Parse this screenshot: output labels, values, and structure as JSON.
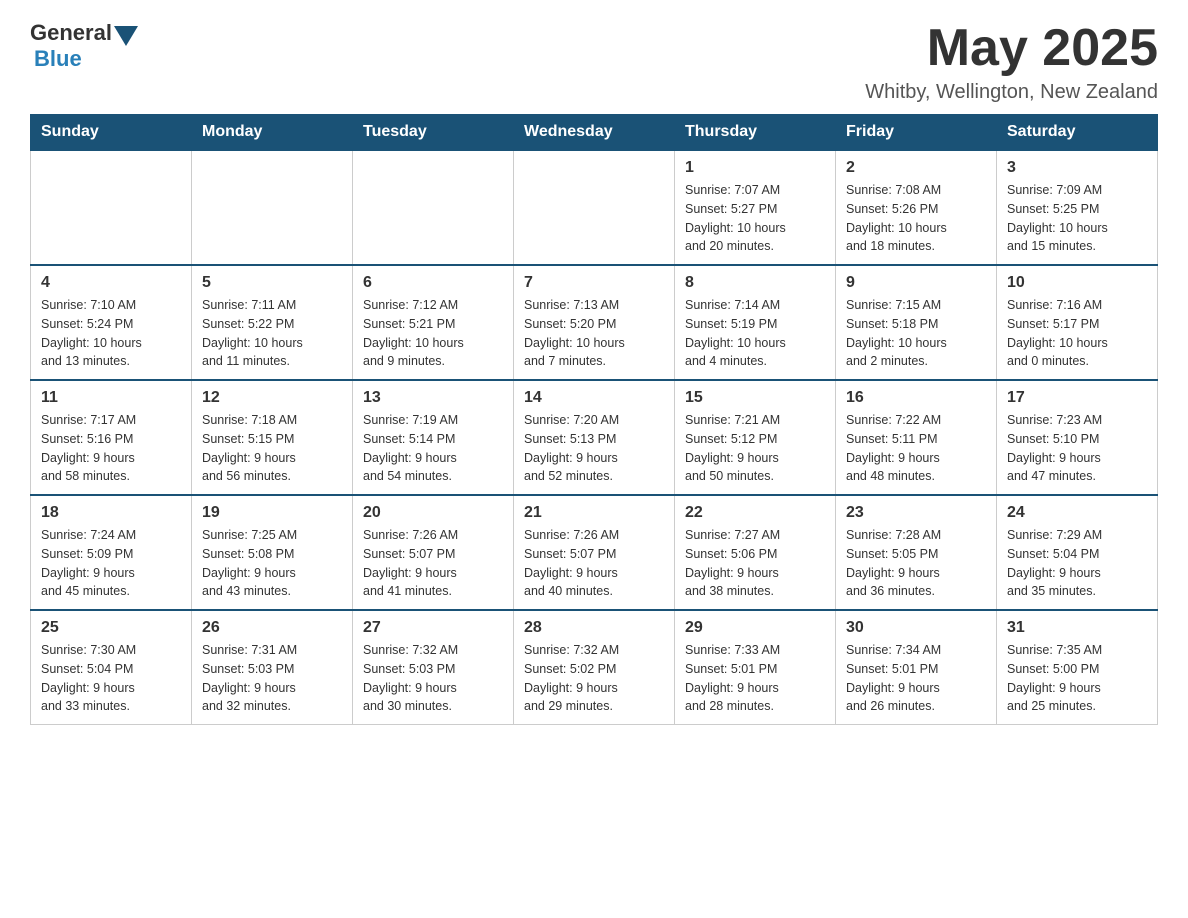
{
  "header": {
    "logo_general": "General",
    "logo_blue": "Blue",
    "month_title": "May 2025",
    "location": "Whitby, Wellington, New Zealand"
  },
  "weekdays": [
    "Sunday",
    "Monday",
    "Tuesday",
    "Wednesday",
    "Thursday",
    "Friday",
    "Saturday"
  ],
  "weeks": [
    [
      {
        "day": "",
        "info": ""
      },
      {
        "day": "",
        "info": ""
      },
      {
        "day": "",
        "info": ""
      },
      {
        "day": "",
        "info": ""
      },
      {
        "day": "1",
        "info": "Sunrise: 7:07 AM\nSunset: 5:27 PM\nDaylight: 10 hours\nand 20 minutes."
      },
      {
        "day": "2",
        "info": "Sunrise: 7:08 AM\nSunset: 5:26 PM\nDaylight: 10 hours\nand 18 minutes."
      },
      {
        "day": "3",
        "info": "Sunrise: 7:09 AM\nSunset: 5:25 PM\nDaylight: 10 hours\nand 15 minutes."
      }
    ],
    [
      {
        "day": "4",
        "info": "Sunrise: 7:10 AM\nSunset: 5:24 PM\nDaylight: 10 hours\nand 13 minutes."
      },
      {
        "day": "5",
        "info": "Sunrise: 7:11 AM\nSunset: 5:22 PM\nDaylight: 10 hours\nand 11 minutes."
      },
      {
        "day": "6",
        "info": "Sunrise: 7:12 AM\nSunset: 5:21 PM\nDaylight: 10 hours\nand 9 minutes."
      },
      {
        "day": "7",
        "info": "Sunrise: 7:13 AM\nSunset: 5:20 PM\nDaylight: 10 hours\nand 7 minutes."
      },
      {
        "day": "8",
        "info": "Sunrise: 7:14 AM\nSunset: 5:19 PM\nDaylight: 10 hours\nand 4 minutes."
      },
      {
        "day": "9",
        "info": "Sunrise: 7:15 AM\nSunset: 5:18 PM\nDaylight: 10 hours\nand 2 minutes."
      },
      {
        "day": "10",
        "info": "Sunrise: 7:16 AM\nSunset: 5:17 PM\nDaylight: 10 hours\nand 0 minutes."
      }
    ],
    [
      {
        "day": "11",
        "info": "Sunrise: 7:17 AM\nSunset: 5:16 PM\nDaylight: 9 hours\nand 58 minutes."
      },
      {
        "day": "12",
        "info": "Sunrise: 7:18 AM\nSunset: 5:15 PM\nDaylight: 9 hours\nand 56 minutes."
      },
      {
        "day": "13",
        "info": "Sunrise: 7:19 AM\nSunset: 5:14 PM\nDaylight: 9 hours\nand 54 minutes."
      },
      {
        "day": "14",
        "info": "Sunrise: 7:20 AM\nSunset: 5:13 PM\nDaylight: 9 hours\nand 52 minutes."
      },
      {
        "day": "15",
        "info": "Sunrise: 7:21 AM\nSunset: 5:12 PM\nDaylight: 9 hours\nand 50 minutes."
      },
      {
        "day": "16",
        "info": "Sunrise: 7:22 AM\nSunset: 5:11 PM\nDaylight: 9 hours\nand 48 minutes."
      },
      {
        "day": "17",
        "info": "Sunrise: 7:23 AM\nSunset: 5:10 PM\nDaylight: 9 hours\nand 47 minutes."
      }
    ],
    [
      {
        "day": "18",
        "info": "Sunrise: 7:24 AM\nSunset: 5:09 PM\nDaylight: 9 hours\nand 45 minutes."
      },
      {
        "day": "19",
        "info": "Sunrise: 7:25 AM\nSunset: 5:08 PM\nDaylight: 9 hours\nand 43 minutes."
      },
      {
        "day": "20",
        "info": "Sunrise: 7:26 AM\nSunset: 5:07 PM\nDaylight: 9 hours\nand 41 minutes."
      },
      {
        "day": "21",
        "info": "Sunrise: 7:26 AM\nSunset: 5:07 PM\nDaylight: 9 hours\nand 40 minutes."
      },
      {
        "day": "22",
        "info": "Sunrise: 7:27 AM\nSunset: 5:06 PM\nDaylight: 9 hours\nand 38 minutes."
      },
      {
        "day": "23",
        "info": "Sunrise: 7:28 AM\nSunset: 5:05 PM\nDaylight: 9 hours\nand 36 minutes."
      },
      {
        "day": "24",
        "info": "Sunrise: 7:29 AM\nSunset: 5:04 PM\nDaylight: 9 hours\nand 35 minutes."
      }
    ],
    [
      {
        "day": "25",
        "info": "Sunrise: 7:30 AM\nSunset: 5:04 PM\nDaylight: 9 hours\nand 33 minutes."
      },
      {
        "day": "26",
        "info": "Sunrise: 7:31 AM\nSunset: 5:03 PM\nDaylight: 9 hours\nand 32 minutes."
      },
      {
        "day": "27",
        "info": "Sunrise: 7:32 AM\nSunset: 5:03 PM\nDaylight: 9 hours\nand 30 minutes."
      },
      {
        "day": "28",
        "info": "Sunrise: 7:32 AM\nSunset: 5:02 PM\nDaylight: 9 hours\nand 29 minutes."
      },
      {
        "day": "29",
        "info": "Sunrise: 7:33 AM\nSunset: 5:01 PM\nDaylight: 9 hours\nand 28 minutes."
      },
      {
        "day": "30",
        "info": "Sunrise: 7:34 AM\nSunset: 5:01 PM\nDaylight: 9 hours\nand 26 minutes."
      },
      {
        "day": "31",
        "info": "Sunrise: 7:35 AM\nSunset: 5:00 PM\nDaylight: 9 hours\nand 25 minutes."
      }
    ]
  ]
}
